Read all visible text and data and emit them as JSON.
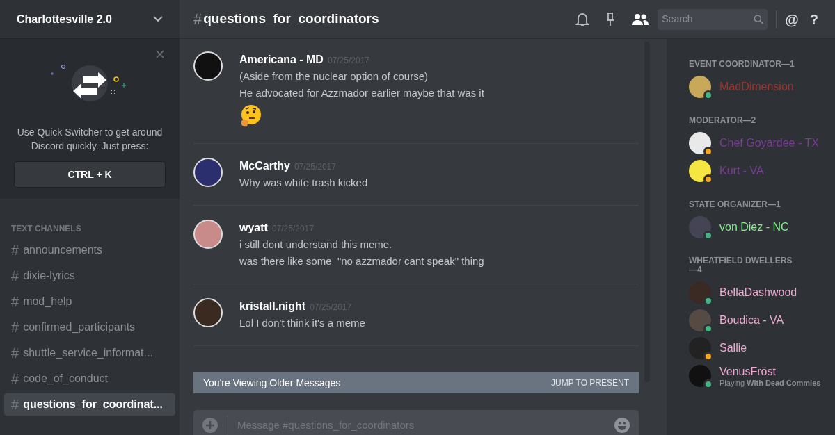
{
  "server": {
    "name": "Charlottesville 2.0"
  },
  "quick_switcher": {
    "text": "Use Quick Switcher to get around Discord quickly. Just press:",
    "shortcut": "CTRL + K"
  },
  "channel_category": "TEXT CHANNELS",
  "channels": [
    {
      "name": "announcements",
      "selected": false
    },
    {
      "name": "dixie-lyrics",
      "selected": false
    },
    {
      "name": "mod_help",
      "selected": false
    },
    {
      "name": "confirmed_participants",
      "selected": false
    },
    {
      "name": "shuttle_service_informat...",
      "selected": false
    },
    {
      "name": "code_of_conduct",
      "selected": false
    },
    {
      "name": "questions_for_coordinat...",
      "selected": true
    }
  ],
  "header": {
    "hash": "#",
    "channel": "questions_for_coordinators",
    "search_placeholder": "Search",
    "at": "@",
    "help": "?"
  },
  "messages": [
    {
      "author": "Americana - MD",
      "time": "07/25/2017",
      "lines": [
        "(Aside from the nuclear option of course)",
        "He advocated for Azzmador earlier maybe that was it"
      ],
      "emoji": true
    },
    {
      "author": "McCarthy",
      "time": "07/25/2017",
      "lines": [
        "Why was white trash kicked"
      ],
      "emoji": false
    },
    {
      "author": "wyatt",
      "time": "07/25/2017",
      "lines": [
        "i still dont understand this meme.",
        "was there like some  \"no azzmador cant speak\" thing"
      ],
      "emoji": false
    },
    {
      "author": "kristall.night",
      "time": "07/25/2017",
      "lines": [
        "Lol I don't think it's a meme"
      ],
      "emoji": false
    }
  ],
  "older_banner": {
    "text": "You're Viewing Older Messages",
    "action": "JUMP TO PRESENT"
  },
  "composer": {
    "placeholder": "Message #questions_for_coordinators"
  },
  "member_groups": [
    {
      "title": "EVENT COORDINATOR—1",
      "members": [
        {
          "name": "MadDimension",
          "color": "#a2332a",
          "idle": false
        }
      ]
    },
    {
      "title": "MODERATOR—2",
      "members": [
        {
          "name": "Chef Goyardee - TX",
          "color": "#7a3e92",
          "idle": true
        },
        {
          "name": "Kurt - VA",
          "color": "#7a3e92",
          "idle": true
        }
      ]
    },
    {
      "title": "STATE ORGANIZER—1",
      "members": [
        {
          "name": "von Diez - NC",
          "color": "#85ef8e",
          "idle": false
        }
      ]
    },
    {
      "title": "WHEATFIELD DWELLERS—4",
      "members": [
        {
          "name": "BellaDashwood",
          "color": "#f0a9d2",
          "idle": false
        },
        {
          "name": "Boudica - VA",
          "color": "#f0a9d2",
          "idle": false
        },
        {
          "name": "Sallie",
          "color": "#f0a9d2",
          "idle": true
        },
        {
          "name": "VenusFröst",
          "color": "#f0a9d2",
          "idle": false,
          "activity": "Playing **With Dead Commies**"
        }
      ]
    }
  ]
}
